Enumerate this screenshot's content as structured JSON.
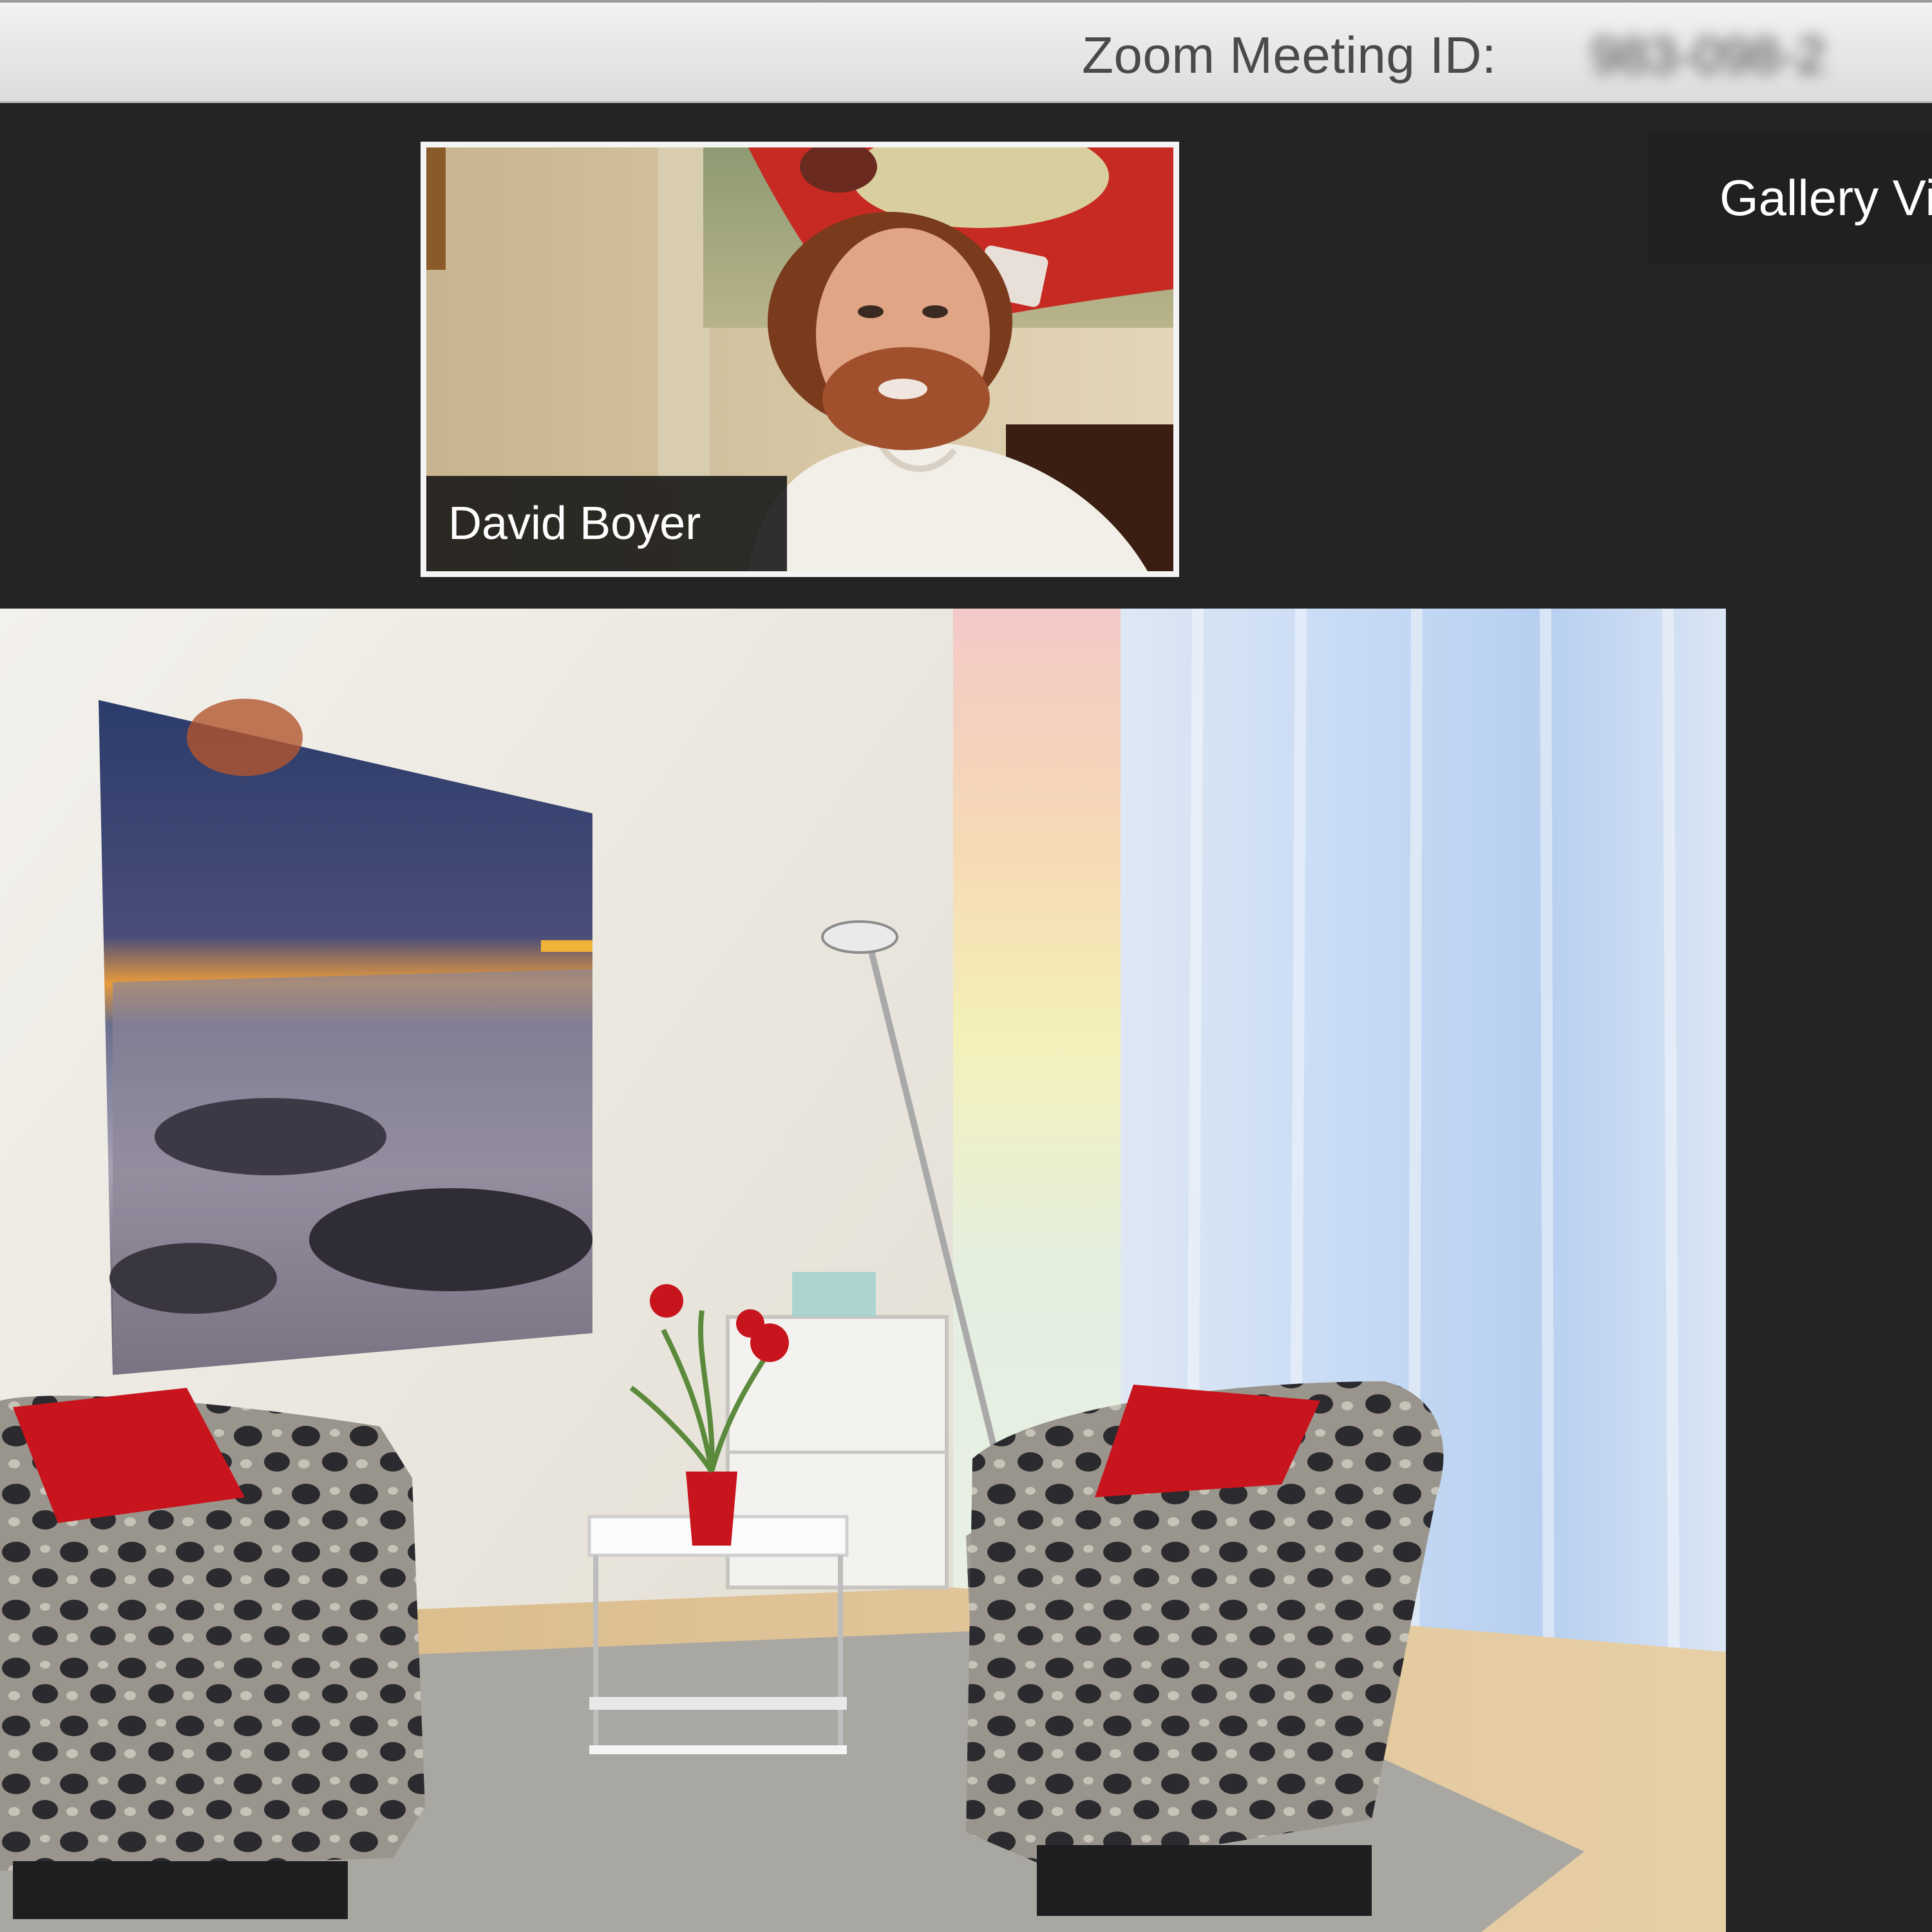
{
  "window": {
    "title_label": "Zoom Meeting ID:",
    "meeting_id": "983-098-2"
  },
  "thumbnail": {
    "participant_name": "David Boyer"
  },
  "view_toggle": {
    "icon": "grid-icon",
    "label": "Gallery View"
  },
  "colors": {
    "title_bar": "#e6e6e6",
    "background": "#232425",
    "thumbnail_border": "#f4f4f4",
    "name_tag": "#141414",
    "cushion_red": "#c8141c"
  }
}
